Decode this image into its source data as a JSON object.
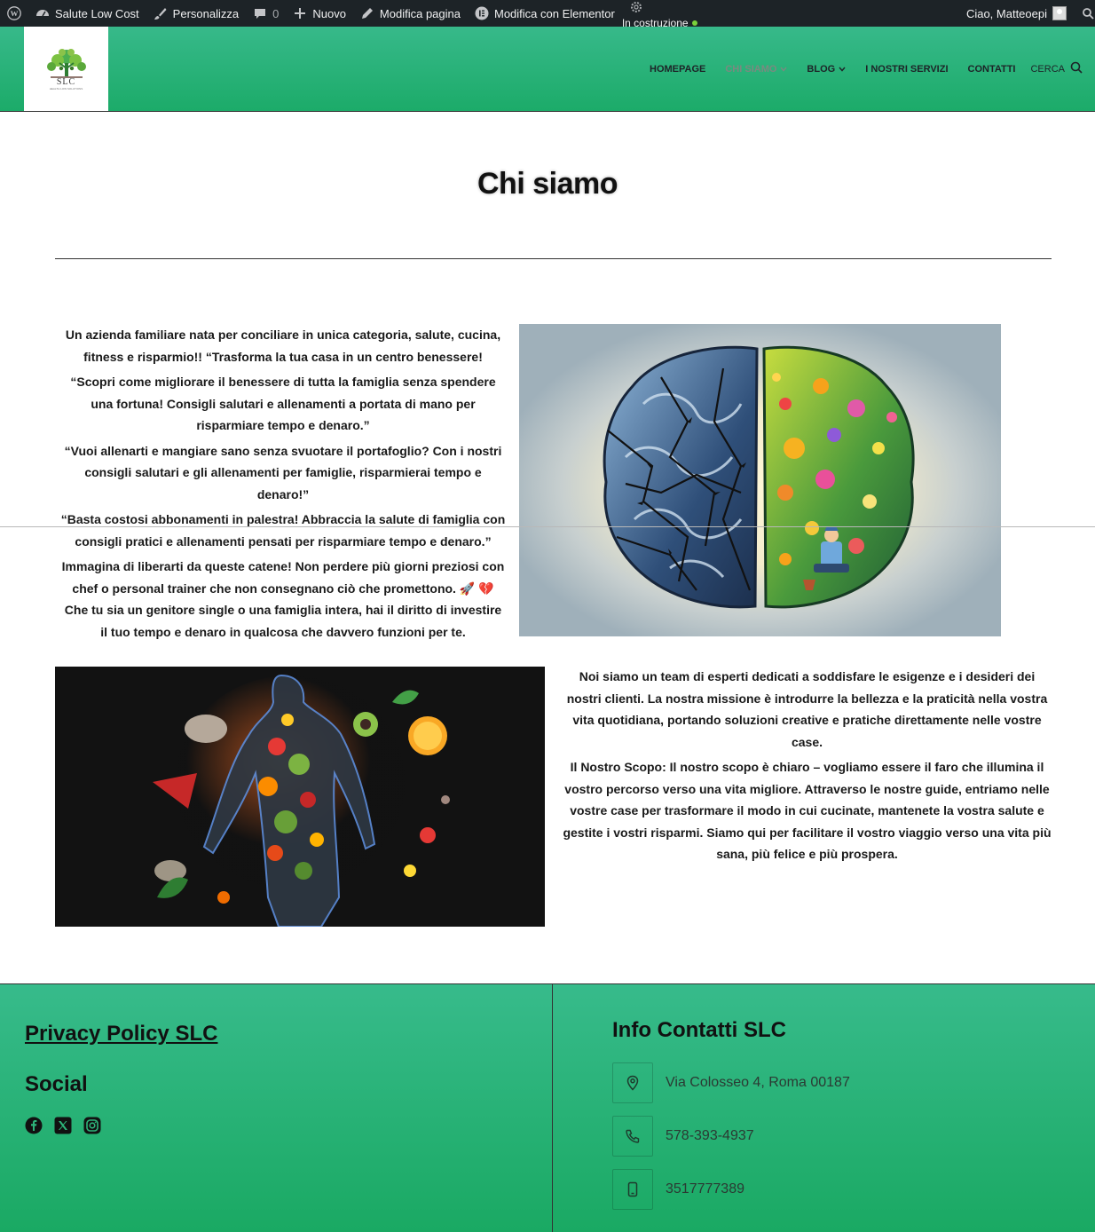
{
  "admin_bar": {
    "site_name": "Salute Low Cost",
    "customize": "Personalizza",
    "comments_count": "0",
    "new": "Nuovo",
    "edit_page": "Modifica pagina",
    "edit_elementor": "Modifica con Elementor",
    "status": "In costruzione",
    "greeting": "Ciao, Matteoepi"
  },
  "header": {
    "logo_text": "SLC",
    "logo_subtext": "HEALTH LOW SOLUTIONS",
    "nav": [
      {
        "label": "HOMEPAGE",
        "active": false,
        "has_dropdown": false
      },
      {
        "label": "CHI SIAMO",
        "active": true,
        "has_dropdown": true
      },
      {
        "label": "BLOG",
        "active": false,
        "has_dropdown": true
      },
      {
        "label": "I NOSTRI SERVIZI",
        "active": false,
        "has_dropdown": false
      },
      {
        "label": "CONTATTI",
        "active": false,
        "has_dropdown": false
      }
    ],
    "search_label": "CERCA"
  },
  "main": {
    "title": "Chi siamo",
    "intro_paragraphs": [
      "Un azienda familiare nata per conciliare in unica categoria,  salute, cucina, fitness e risparmio!! “Trasforma la tua casa in un centro benessere!",
      "“Scopri come migliorare il benessere di tutta la famiglia senza spendere una fortuna! Consigli salutari e allenamenti a portata di mano per risparmiare tempo e denaro.”",
      "“Vuoi allenarti e mangiare sano senza svuotare il portafoglio? Con i nostri consigli salutari e gli allenamenti per famiglie, risparmierai tempo e denaro!”",
      "“Basta costosi abbonamenti in palestra! Abbraccia la salute di famiglia con consigli pratici e allenamenti pensati per risparmiare tempo e denaro.”",
      "Immagina di liberarti da queste catene! Non perdere più giorni preziosi con chef o personal trainer che non consegnano ciò che promettono. 🚀 💔 Che tu sia un genitore single o una famiglia intera, hai il diritto di investire il tuo tempo e denaro in qualcosa che davvero funzioni per te."
    ],
    "mission_paragraphs": [
      "Noi siamo  un team di esperti dedicati a soddisfare le esigenze e i desideri dei nostri clienti. La nostra missione è introdurre la bellezza e la praticità nella vostra vita quotidiana, portando soluzioni creative e pratiche direttamente nelle vostre case.",
      "Il Nostro Scopo: Il nostro scopo è chiaro – vogliamo essere il faro che illumina il vostro percorso verso una vita migliore. Attraverso le nostre guide, entriamo nelle vostre case per trasformare il modo in cui cucinate, mantenete la vostra salute e gestite i vostri risparmi. Siamo qui per facilitare il vostro viaggio verso una vita più sana, più felice e più prospera."
    ]
  },
  "footer": {
    "privacy_link": "Privacy Policy SLC",
    "social_heading": "Social",
    "social_icons": [
      "facebook-icon",
      "x-twitter-icon",
      "instagram-icon"
    ],
    "contact_heading": "Info Contatti SLC",
    "contacts": [
      {
        "icon": "location-pin-icon",
        "text": "Via Colosseo 4, Roma 00187"
      },
      {
        "icon": "phone-icon",
        "text": "578-393-4937"
      },
      {
        "icon": "mobile-icon",
        "text": "3517777389"
      }
    ]
  },
  "colors": {
    "header_green": "#1cab69",
    "footer_green": "#1aa963",
    "admin_bar": "#1d2327",
    "status_dot": "#7ad03a"
  }
}
